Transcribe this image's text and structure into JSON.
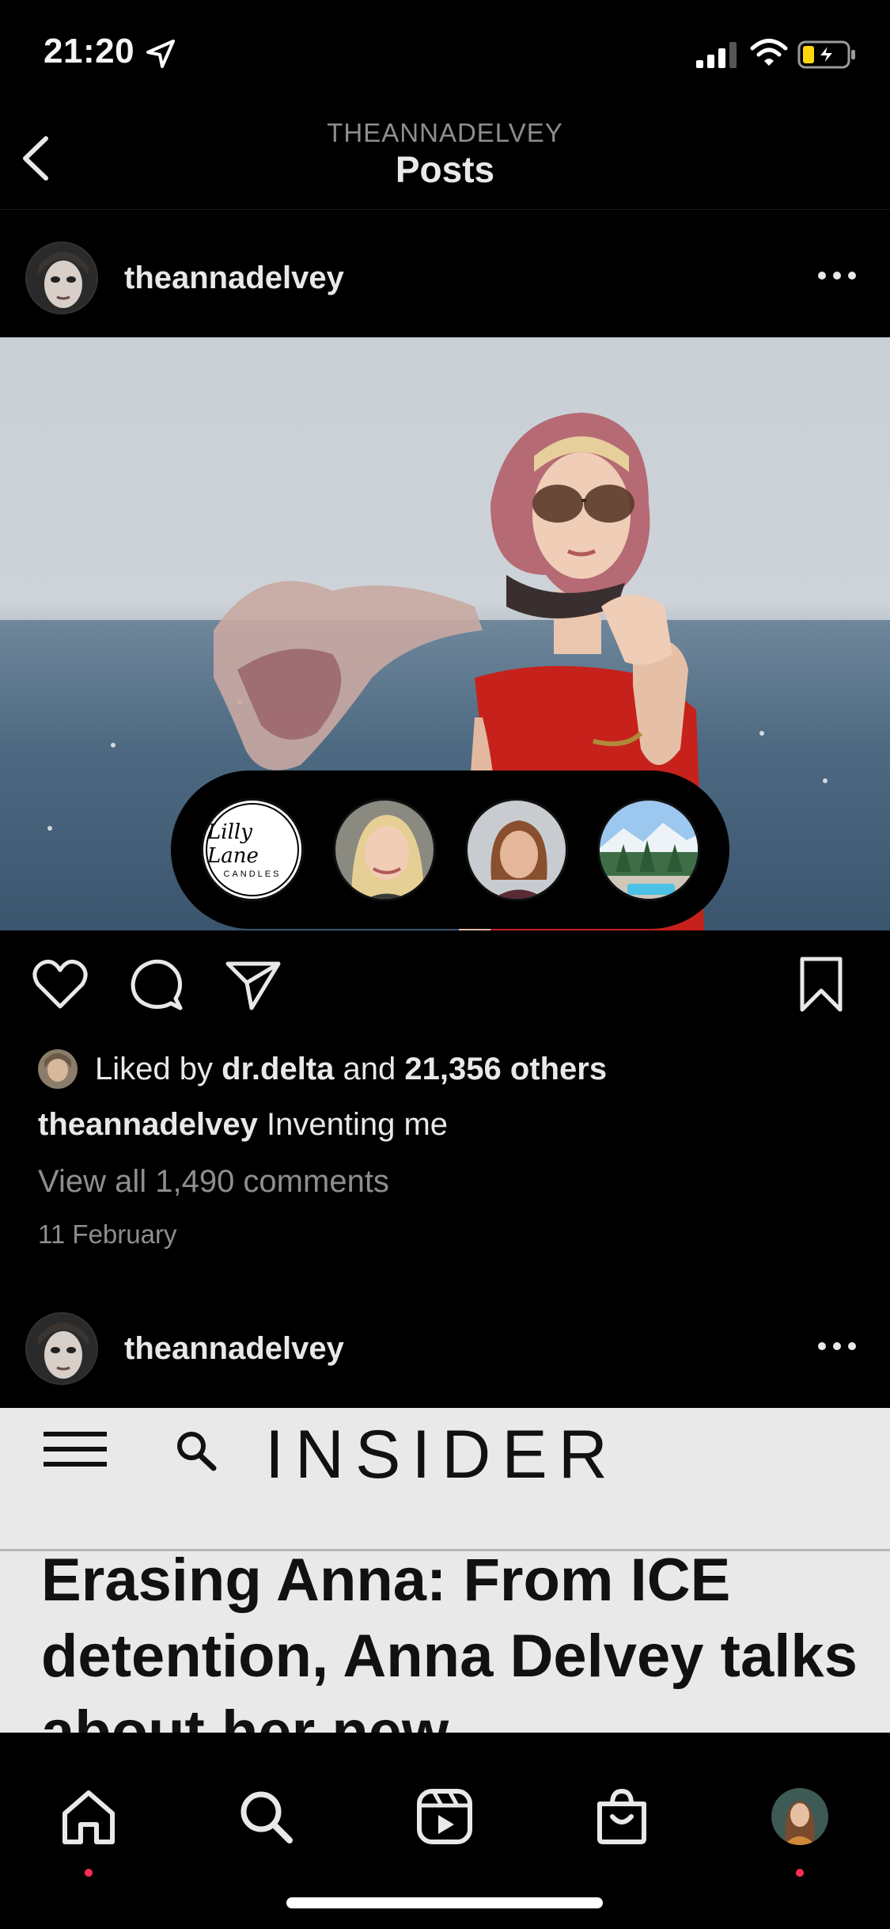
{
  "status_bar": {
    "time": "21:20"
  },
  "header": {
    "account": "THEANNADELVEY",
    "title": "Posts"
  },
  "post1": {
    "username": "theannadelvey",
    "liked_prefix": "Liked by",
    "liked_user": "dr.delta",
    "liked_and": "and",
    "liked_count": "21,356 others",
    "caption_user": "theannadelvey",
    "caption_text": "Inventing me",
    "view_comments": "View all 1,490 comments",
    "date": "11 February",
    "brand_tags": [
      {
        "name": "Lilly Lane",
        "sub": "CANDLES"
      }
    ]
  },
  "post2": {
    "username": "theannadelvey",
    "article_brand": "INSIDER",
    "article_headline": "Erasing Anna: From ICE detention, Anna Delvey talks about her new"
  },
  "tab_bar": {
    "items": [
      "home-icon",
      "search-icon",
      "reels-icon",
      "shop-icon",
      "profile-avatar"
    ],
    "dot_color": "#ff2d55"
  }
}
